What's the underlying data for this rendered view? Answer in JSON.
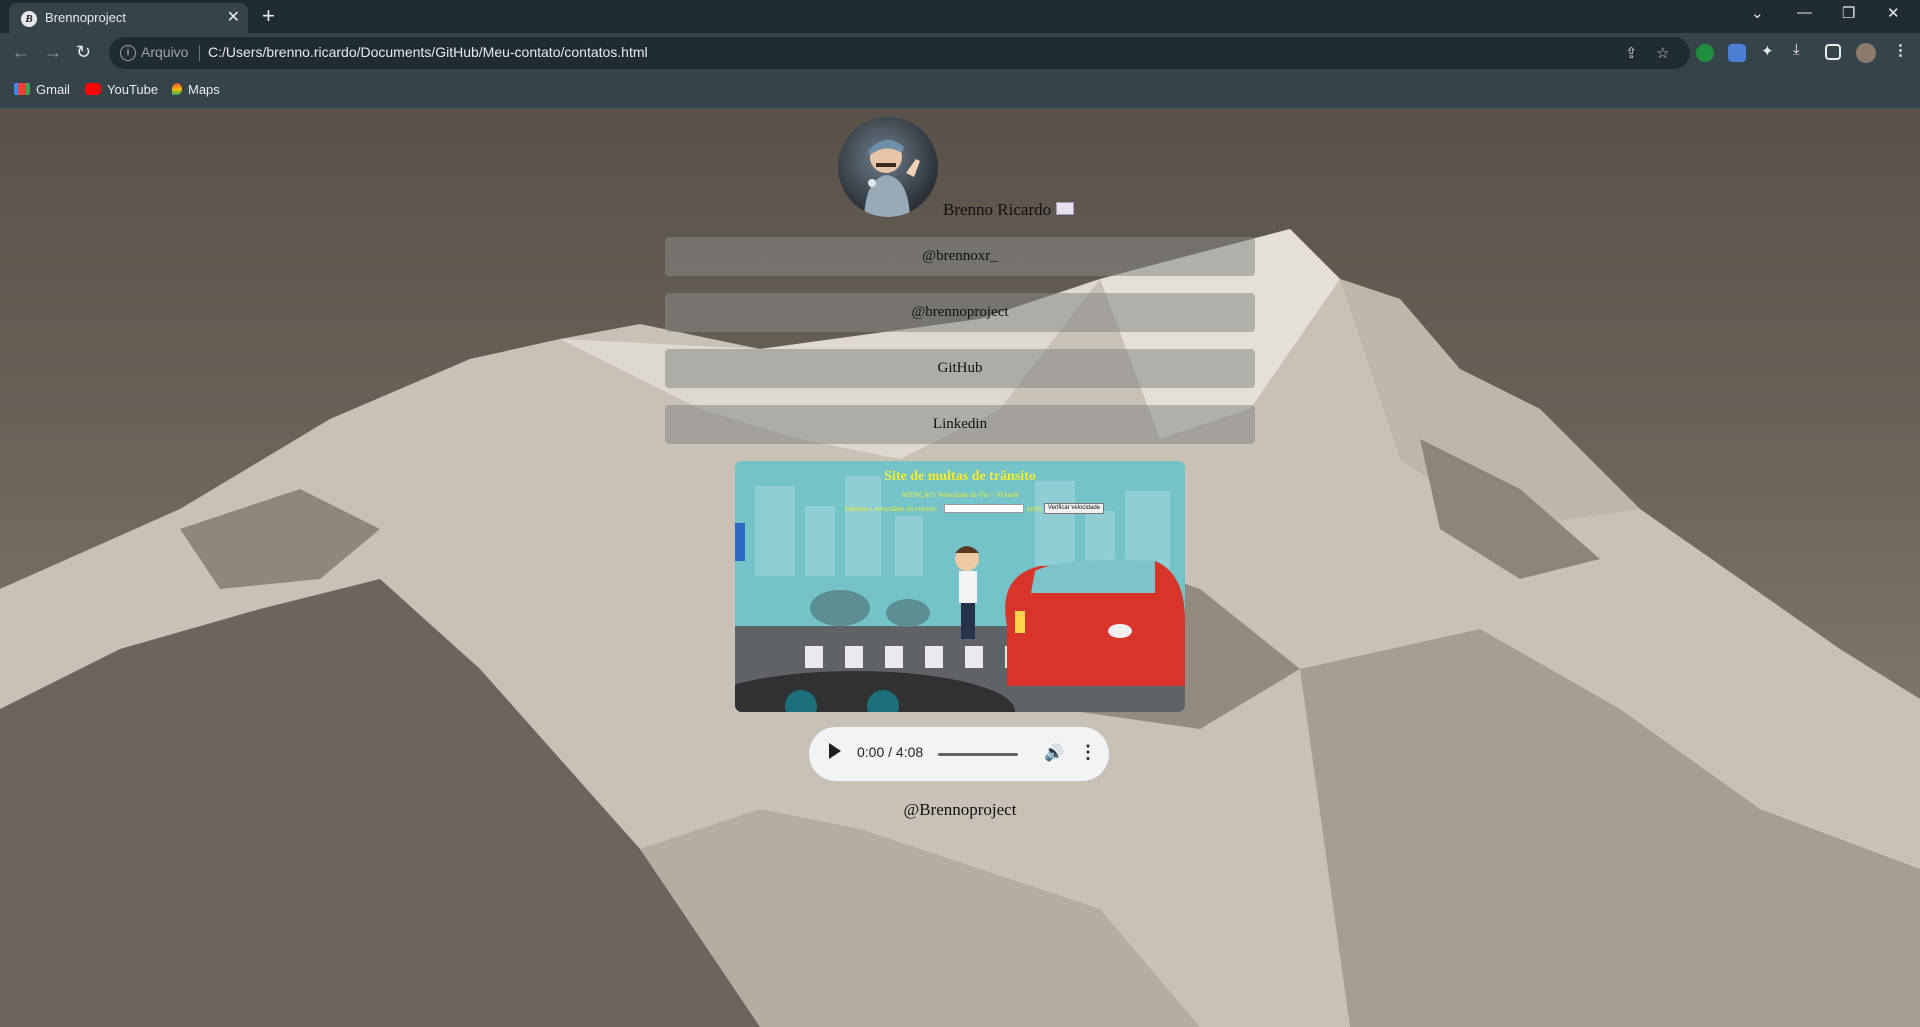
{
  "browser": {
    "tab": {
      "title": "Brennoproject",
      "favicon": "B"
    },
    "address": {
      "security_chip": "Arquivo",
      "url": "C:/Users/brenno.ricardo/Documents/GitHub/Meu-contato/contatos.html"
    },
    "bookmarks": [
      {
        "label": "Gmail",
        "icon": "gmail-icon"
      },
      {
        "label": "YouTube",
        "icon": "youtube-icon"
      },
      {
        "label": "Maps",
        "icon": "maps-icon"
      }
    ]
  },
  "profile": {
    "name": "Brenno Ricardo"
  },
  "links": [
    {
      "label": "@brennoxr_"
    },
    {
      "label": "@brennoproject"
    },
    {
      "label": "GitHub"
    },
    {
      "label": "Linkedin"
    }
  ],
  "embed": {
    "title": "Site de multas de trânsito",
    "warning": "ATENÇÃO: Velocidade da Via = 50 km/h",
    "input_label": "Informe a velocidade do veículo:",
    "unit": "km/h",
    "button_label": "Verificar velocidade"
  },
  "audio": {
    "time": "0:00 / 4:08"
  },
  "footer": {
    "handle": "@Brennoproject"
  },
  "colors": {
    "embed_text": "#f6ec2d",
    "button_bg": "rgba(135,135,135,0.55)"
  }
}
